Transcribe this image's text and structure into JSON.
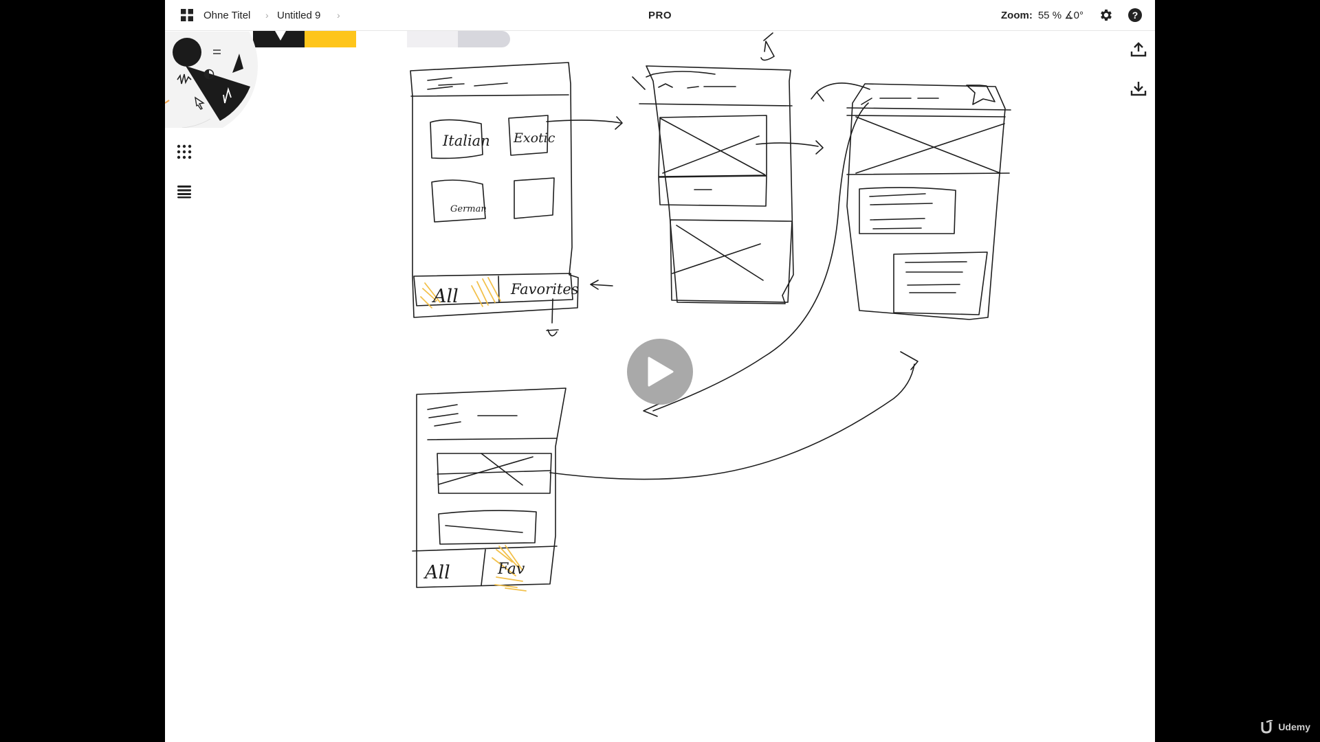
{
  "header": {
    "breadcrumb": [
      "Ohne Titel",
      "Untitled 9"
    ],
    "separator": "›",
    "center_label": "PRO",
    "zoom_label": "Zoom:",
    "zoom_value": "55 % ∡0°"
  },
  "sketch_labels": {
    "tile_1": "Italian",
    "tile_2": "Exotic",
    "tile_3": "German",
    "tab_all": "All",
    "tab_favorites": "Favorites",
    "bottom_tab_all": "All",
    "bottom_tab_fav": "Fav"
  },
  "colors": {
    "swatch_primary": "#1b1b1b",
    "swatch_secondary": "#fec51b",
    "highlight": "#f2c04a"
  },
  "icons": [
    "grid-menu-icon",
    "gear-icon",
    "help-icon",
    "brush-grid-icon",
    "layers-icon",
    "export-icon",
    "import-icon",
    "play-icon",
    "udemy-logo"
  ],
  "watermark": "Udemy"
}
